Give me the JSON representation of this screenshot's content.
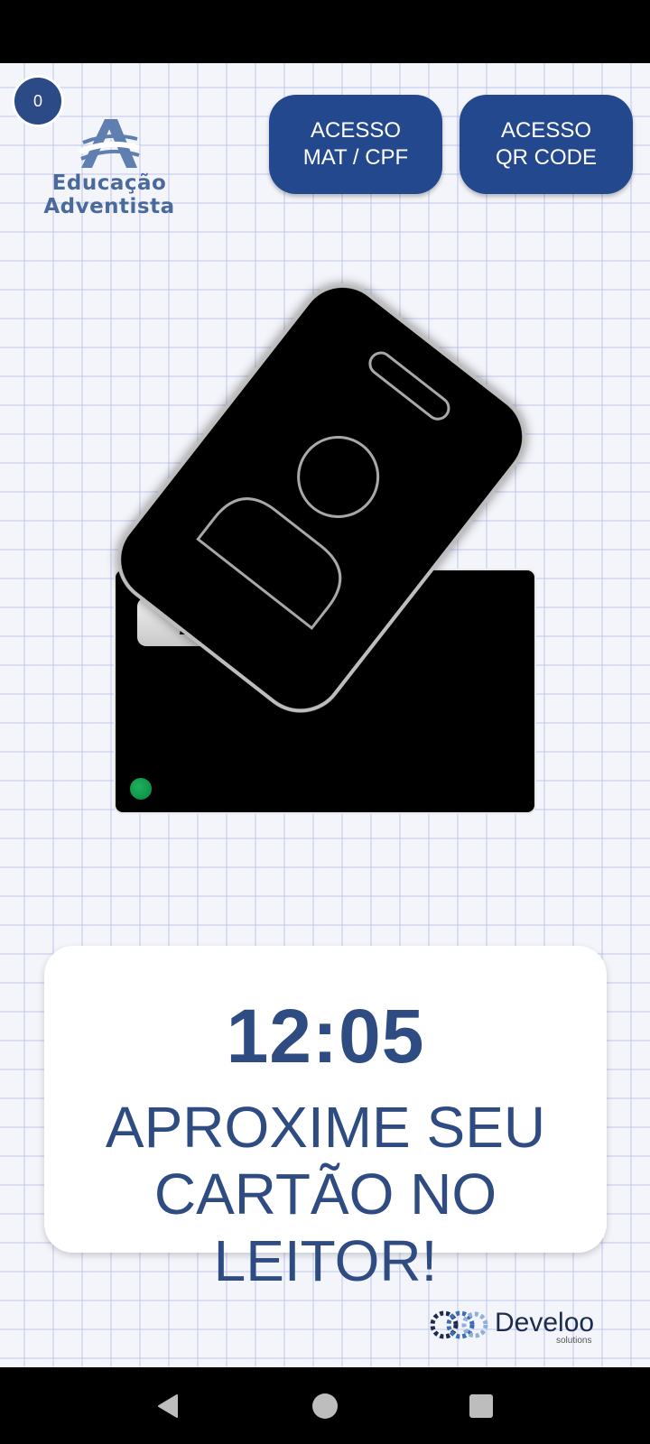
{
  "counter": {
    "value": "0"
  },
  "logo": {
    "line1": "Educação",
    "line2": "Adventista",
    "color": "#4a6a9c"
  },
  "buttons": {
    "cpf_label": "ACESSO\nMAT / CPF",
    "qr_label": "ACESSO\nQR CODE",
    "color": "#23488d"
  },
  "reader": {
    "label": "DVC",
    "led_color": "#0a9a48"
  },
  "badge": {
    "icon": "id-badge-icon"
  },
  "card": {
    "time": "12:05",
    "prompt": "APROXIME SEU\nCARTÃO NO LEITOR!",
    "text_color": "#2e4c82"
  },
  "footer": {
    "brand": "Develoo",
    "sub": "solutions"
  },
  "navbar": {
    "back": "back-icon",
    "home": "home-icon",
    "recents": "recents-icon"
  }
}
